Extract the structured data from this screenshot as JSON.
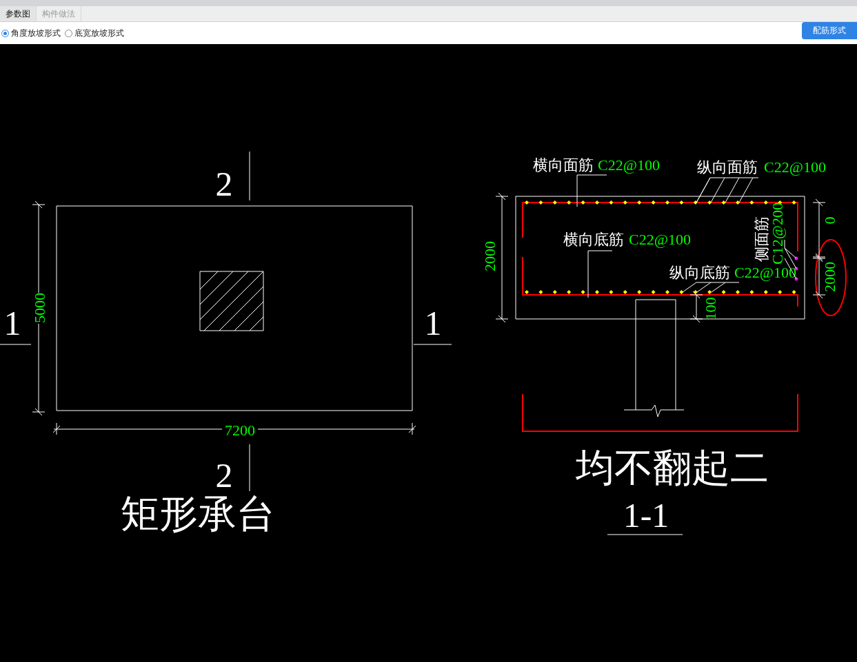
{
  "tabs": [
    {
      "label": "参数图",
      "selected": true
    },
    {
      "label": "构件做法",
      "selected": false
    }
  ],
  "options": [
    {
      "label": "角度放坡形式",
      "selected": true
    },
    {
      "label": "底宽放坡形式",
      "selected": false
    }
  ],
  "action_button": "配筋形式",
  "plan": {
    "section_marks": [
      "2",
      "2",
      "1",
      "1"
    ],
    "width_dim": "7200",
    "height_dim": "5000",
    "title": "矩形承台"
  },
  "section": {
    "rebar_labels": [
      {
        "name": "横向面筋",
        "spec": "C22@100"
      },
      {
        "name": "纵向面筋",
        "spec": "C22@100"
      },
      {
        "name": "横向底筋",
        "spec": "C22@100"
      },
      {
        "name": "纵向底筋",
        "spec": "C22@100"
      },
      {
        "name": "侧面筋",
        "spec": "C12@200"
      }
    ],
    "dims": [
      "2000",
      "0",
      "2000",
      "100"
    ],
    "title": "均不翻起二",
    "section_name": "1-1"
  }
}
